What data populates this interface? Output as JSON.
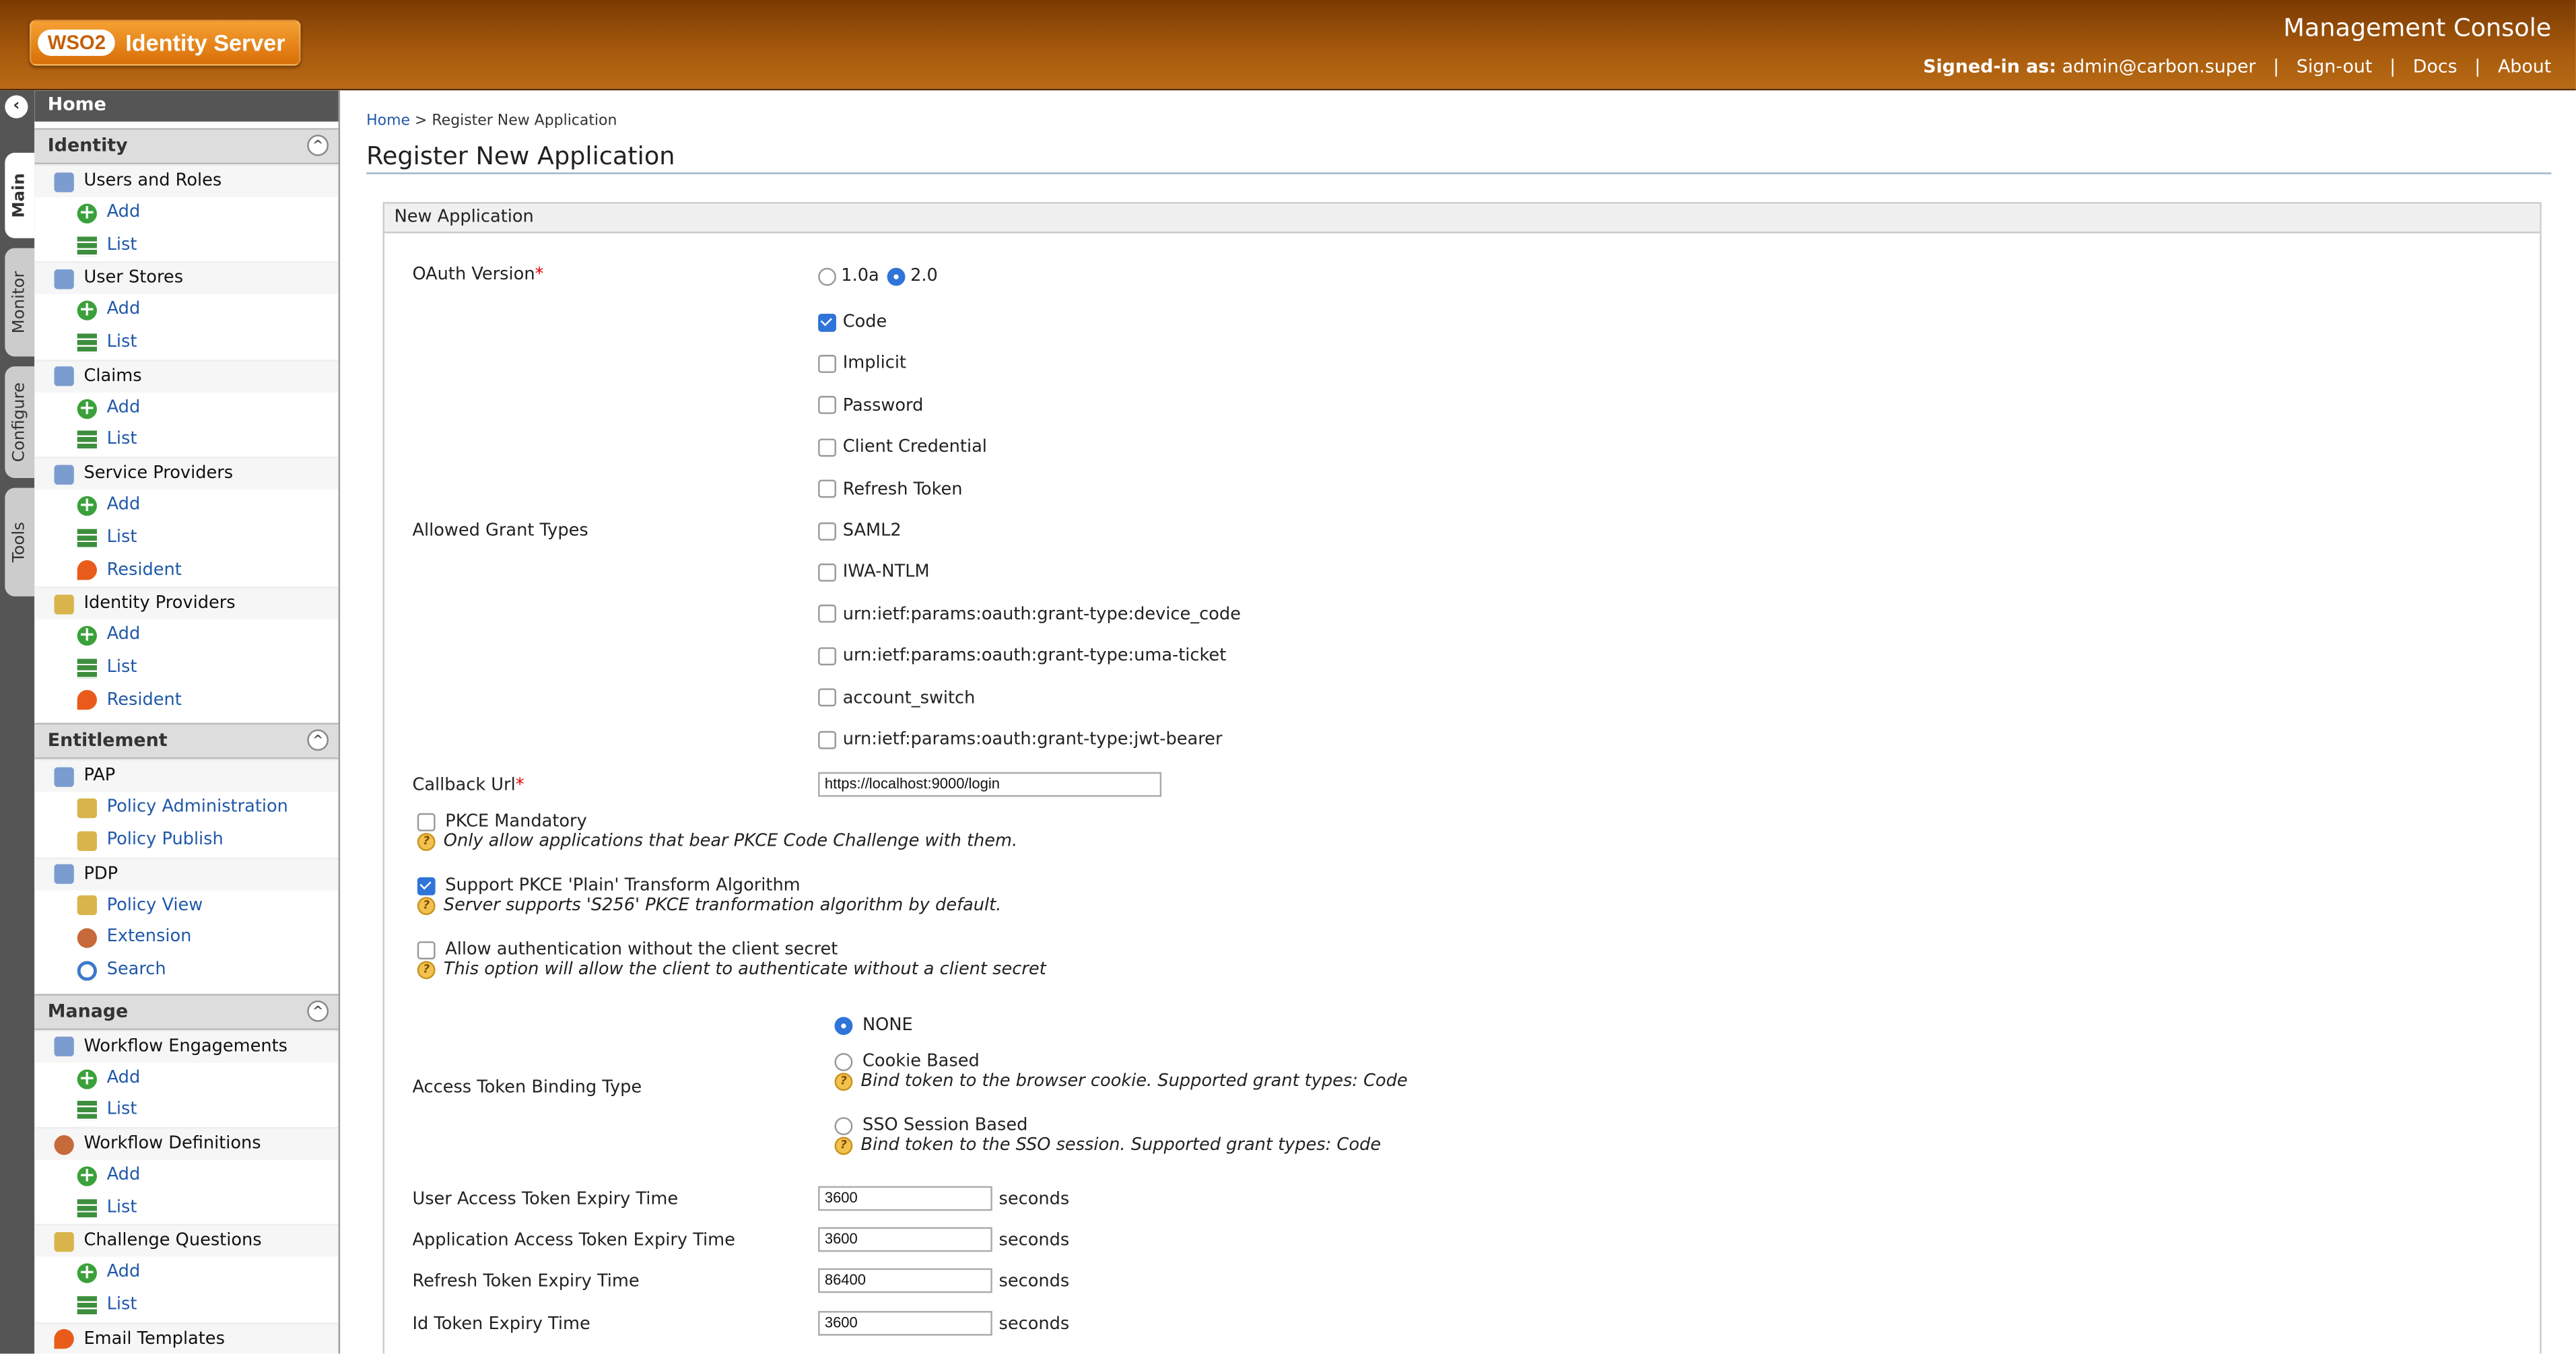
{
  "header": {
    "logo_wso": "WSO2",
    "logo_product": "Identity Server",
    "title": "Management Console",
    "signed_in_label": "Signed-in as:",
    "signed_in_user": "admin@carbon.super",
    "sign_out": "Sign-out",
    "docs": "Docs",
    "about": "About"
  },
  "tabs": [
    "Main",
    "Monitor",
    "Configure",
    "Tools"
  ],
  "nav": {
    "home": "Home",
    "sections": [
      {
        "title": "Identity"
      },
      {
        "title": "Entitlement"
      },
      {
        "title": "Manage"
      }
    ],
    "identity": [
      {
        "label": "Users and Roles",
        "items": [
          "Add",
          "List"
        ]
      },
      {
        "label": "User Stores",
        "items": [
          "Add",
          "List"
        ]
      },
      {
        "label": "Claims",
        "items": [
          "Add",
          "List"
        ]
      },
      {
        "label": "Service Providers",
        "items": [
          "Add",
          "List",
          "Resident"
        ]
      },
      {
        "label": "Identity Providers",
        "items": [
          "Add",
          "List",
          "Resident"
        ]
      }
    ],
    "entitlement": [
      {
        "label": "PAP",
        "items": [
          "Policy Administration",
          "Policy Publish"
        ]
      },
      {
        "label": "PDP",
        "items": [
          "Policy View",
          "Extension",
          "Search"
        ]
      }
    ],
    "manage": [
      {
        "label": "Workflow Engagements",
        "items": [
          "Add",
          "List"
        ]
      },
      {
        "label": "Workflow Definitions",
        "items": [
          "Add",
          "List"
        ]
      },
      {
        "label": "Challenge Questions",
        "items": [
          "Add",
          "List"
        ]
      },
      {
        "label": "Email Templates",
        "items": []
      }
    ]
  },
  "breadcrumb": {
    "home": "Home",
    "sep": ">",
    "current": "Register New Application"
  },
  "page_title": "Register New Application",
  "form": {
    "section_title": "New Application",
    "oauth_version_label": "OAuth Version",
    "req": "*",
    "oauth_versions": [
      "1.0a",
      "2.0"
    ],
    "oauth_selected": "2.0",
    "grant_types_label": "Allowed Grant Types",
    "grant_types": [
      {
        "label": "Code",
        "checked": true
      },
      {
        "label": "Implicit",
        "checked": false
      },
      {
        "label": "Password",
        "checked": false
      },
      {
        "label": "Client Credential",
        "checked": false
      },
      {
        "label": "Refresh Token",
        "checked": false
      },
      {
        "label": "SAML2",
        "checked": false
      },
      {
        "label": "IWA-NTLM",
        "checked": false
      },
      {
        "label": "urn:ietf:params:oauth:grant-type:device_code",
        "checked": false
      },
      {
        "label": "urn:ietf:params:oauth:grant-type:uma-ticket",
        "checked": false
      },
      {
        "label": "account_switch",
        "checked": false
      },
      {
        "label": "urn:ietf:params:oauth:grant-type:jwt-bearer",
        "checked": false
      }
    ],
    "callback_label": "Callback Url",
    "callback_value": "https://localhost:9000/login",
    "pkce_mandatory": {
      "label": "PKCE Mandatory",
      "checked": false,
      "hint": "Only allow applications that bear PKCE Code Challenge with them."
    },
    "pkce_plain": {
      "label": "Support PKCE 'Plain' Transform Algorithm",
      "checked": true,
      "hint": "Server supports 'S256' PKCE tranformation algorithm by default."
    },
    "no_secret": {
      "label": "Allow authentication without the client secret",
      "checked": false,
      "hint": "This option will allow the client to authenticate without a client secret"
    },
    "binding_label": "Access Token Binding Type",
    "binding_options": [
      {
        "label": "NONE",
        "selected": true,
        "hint": ""
      },
      {
        "label": "Cookie Based",
        "selected": false,
        "hint": "Bind token to the browser cookie. Supported grant types: Code"
      },
      {
        "label": "SSO Session Based",
        "selected": false,
        "hint": "Bind token to the SSO session. Supported grant types: Code"
      }
    ],
    "help_glyph": "?",
    "expiry": [
      {
        "label": "User Access Token Expiry Time",
        "value": "3600",
        "unit": "seconds"
      },
      {
        "label": "Application Access Token Expiry Time",
        "value": "3600",
        "unit": "seconds"
      },
      {
        "label": "Refresh Token Expiry Time",
        "value": "86400",
        "unit": "seconds"
      },
      {
        "label": "Id Token Expiry Time",
        "value": "3600",
        "unit": "seconds"
      }
    ]
  },
  "colors": {
    "header": "#a85b0d",
    "accent": "#2f74d8",
    "link": "#2159a9"
  }
}
